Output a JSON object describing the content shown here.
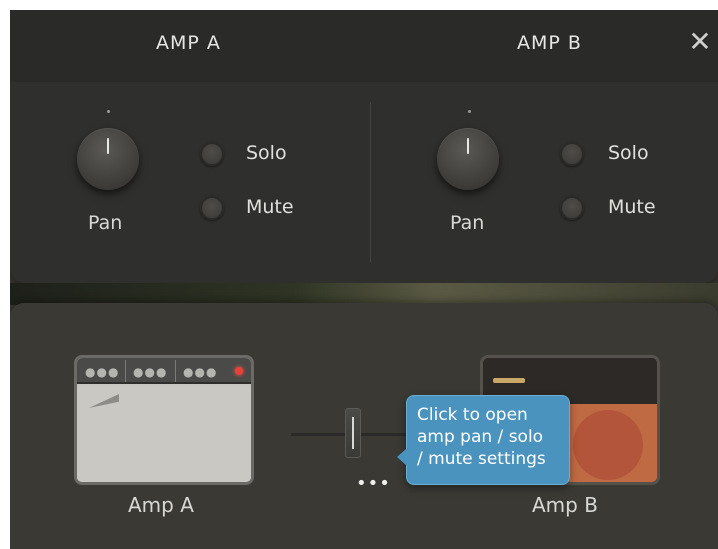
{
  "header": {
    "amp_a_title": "AMP A",
    "amp_b_title": "AMP B",
    "close_glyph": "✕"
  },
  "channel_a": {
    "pan_label": "Pan",
    "pan_value": 0,
    "solo_label": "Solo",
    "mute_label": "Mute"
  },
  "channel_b": {
    "pan_label": "Pan",
    "pan_value": 0,
    "solo_label": "Solo",
    "mute_label": "Mute"
  },
  "mixer": {
    "amp_a_label": "Amp A",
    "amp_b_label": "Amp B",
    "crossfade_value": 0.5,
    "more_glyph": "•••"
  },
  "tooltip": {
    "lines": [
      "Click to open",
      "amp pan / solo",
      "/ mute settings"
    ]
  },
  "icons": {
    "close": "close-icon",
    "more": "more-icon"
  },
  "colors": {
    "panel": "#2f2f2d",
    "tooltip": "#4a93be",
    "led": "#e8403a",
    "amp_b_cab": "#c06a44"
  }
}
